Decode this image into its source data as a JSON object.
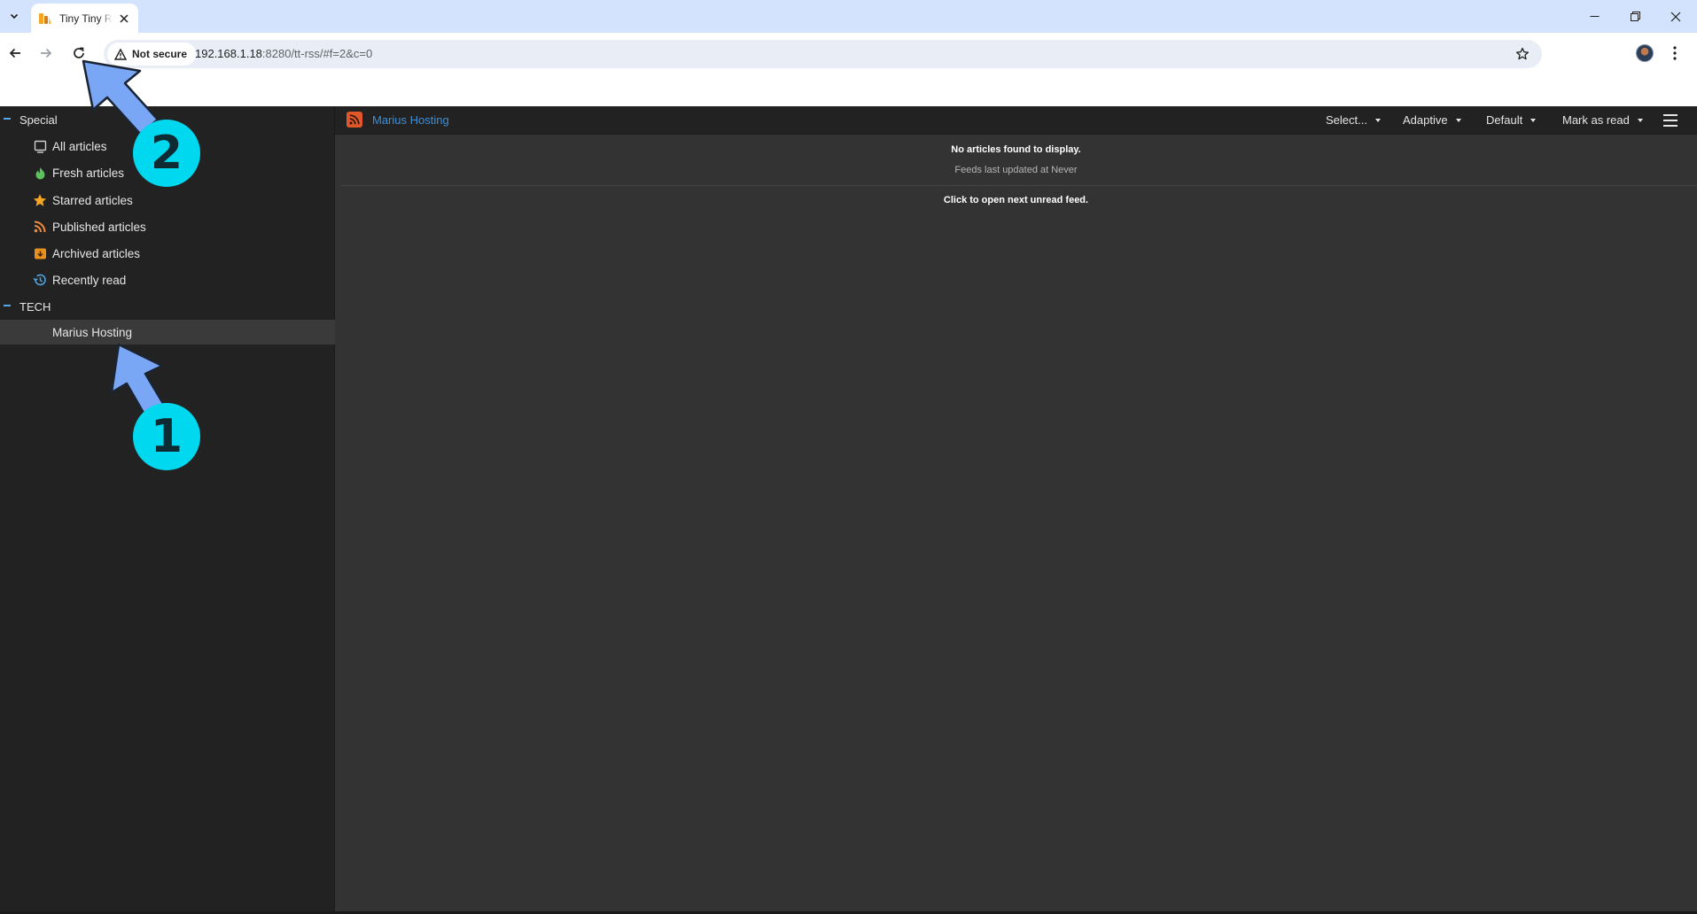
{
  "browser": {
    "tab_title": "Tiny Tiny RSS",
    "security_label": "Not secure",
    "url_host": "192.168.1.18",
    "url_rest": ":8280/tt-rss/#f=2&c=0"
  },
  "sidebar": {
    "categories": [
      {
        "label": "Special"
      },
      {
        "label": "TECH"
      }
    ],
    "special_items": [
      {
        "label": "All articles",
        "icon": "inbox-icon"
      },
      {
        "label": "Fresh articles",
        "icon": "fresh-icon"
      },
      {
        "label": "Starred articles",
        "icon": "star-icon"
      },
      {
        "label": "Published articles",
        "icon": "rss-icon"
      },
      {
        "label": "Archived articles",
        "icon": "archive-icon"
      },
      {
        "label": "Recently read",
        "icon": "history-icon"
      }
    ],
    "tech_items": [
      {
        "label": "Marius Hosting",
        "selected": true
      }
    ]
  },
  "main": {
    "feed_title": "Marius Hosting",
    "toolbar": {
      "select_label": "Select...",
      "view_label": "Adaptive",
      "sort_label": "Default",
      "mark_read_label": "Mark as read"
    },
    "no_articles": "No articles found to display.",
    "last_updated": "Feeds last updated at Never",
    "next_unread": "Click to open next unread feed."
  },
  "annotations": {
    "badge_1": "1",
    "badge_2": "2"
  },
  "colors": {
    "accent_link": "#3f8fd6",
    "badge": "#00d8ef",
    "arrow": "#7aa7f5",
    "sidebar_bg": "#222222",
    "main_bg": "#333333"
  }
}
